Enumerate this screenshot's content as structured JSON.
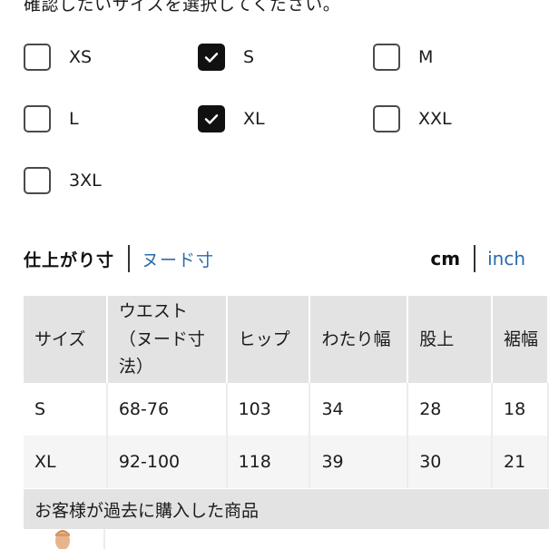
{
  "instruction": "確認したいサイズを選択してください。",
  "sizes": [
    {
      "label": "XS",
      "checked": false
    },
    {
      "label": "S",
      "checked": true
    },
    {
      "label": "M",
      "checked": false
    },
    {
      "label": "L",
      "checked": false
    },
    {
      "label": "XL",
      "checked": true
    },
    {
      "label": "XXL",
      "checked": false
    },
    {
      "label": "3XL",
      "checked": false
    }
  ],
  "tabs": {
    "active": "仕上がり寸",
    "other": "ヌード寸"
  },
  "units": {
    "active": "cm",
    "other": "inch"
  },
  "table": {
    "headers": {
      "size": "サイズ",
      "waist_line1": "ウエスト",
      "waist_line2": "（ヌード寸法）",
      "hip": "ヒップ",
      "thigh": "わたり幅",
      "rise": "股上",
      "hem": "裾幅"
    },
    "rows": [
      {
        "size": "S",
        "waist": "68-76",
        "hip": "103",
        "thigh": "34",
        "rise": "28",
        "hem": "18"
      },
      {
        "size": "XL",
        "waist": "92-100",
        "hip": "118",
        "thigh": "39",
        "rise": "30",
        "hem": "21"
      }
    ]
  },
  "purchased": {
    "title": "お客様が過去に購入した商品"
  },
  "colors": {
    "accent_link": "#2a6ca8",
    "header_bg": "#e3e3e3",
    "checked_bg": "#111111"
  }
}
